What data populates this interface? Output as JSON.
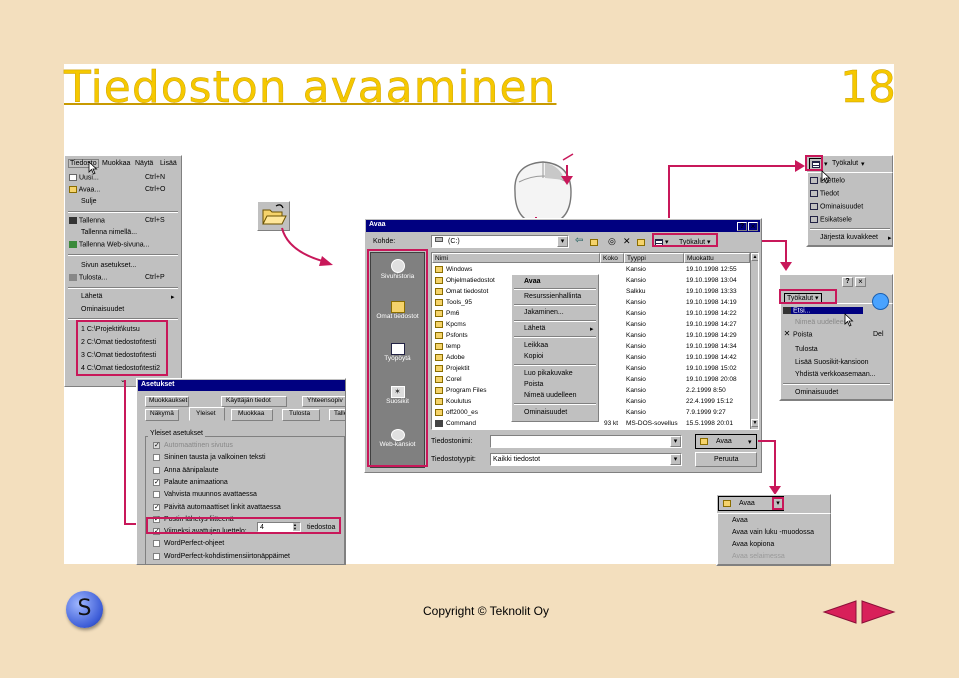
{
  "slide": {
    "title": "Tiedoston avaaminen",
    "page": "18",
    "footer": "Copyright © Teknolit Oy",
    "logo_letter": "S"
  },
  "menu": {
    "bar": [
      "Tiedosto",
      "Muokkaa",
      "Näytä",
      "Lisää"
    ],
    "items": [
      {
        "label": "Uusi...",
        "shortcut": "Ctrl+N"
      },
      {
        "label": "Avaa...",
        "shortcut": "Ctrl+O"
      },
      {
        "label": "Sulje",
        "shortcut": ""
      },
      {
        "label": "Tallenna",
        "shortcut": "Ctrl+S"
      },
      {
        "label": "Tallenna nimellä...",
        "shortcut": ""
      },
      {
        "label": "Tallenna Web-sivuna...",
        "shortcut": ""
      },
      {
        "label": "Sivun asetukset...",
        "shortcut": ""
      },
      {
        "label": "Tulosta...",
        "shortcut": "Ctrl+P"
      },
      {
        "label": "Lähetä",
        "shortcut": "▸"
      },
      {
        "label": "Ominaisuudet",
        "shortcut": ""
      }
    ],
    "recent": [
      "1 C:\\Projektit\\kutsu",
      "2 C:\\Omat tiedostot\\testi",
      "3 C:\\Omat tiedostot\\testi",
      "4 C:\\Omat tiedostot\\testi2"
    ],
    "more": "⌄"
  },
  "dialog": {
    "title": "Avaa",
    "help": "?",
    "close": "×",
    "lookin_label": "Kohde:",
    "lookin_value": "(C:)",
    "tools": "Työkalut",
    "places": [
      "Sivuhistoria",
      "Omat tiedostot",
      "Työpöytä",
      "Suosikit",
      "Web-kansiot"
    ],
    "columns": [
      "Nimi",
      "Koko",
      "Tyyppi",
      "Muokattu"
    ],
    "files": [
      {
        "name": "Windows",
        "size": "",
        "type": "Kansio",
        "date": "19.10.1998 12:55"
      },
      {
        "name": "Ohjelmatiedostot",
        "size": "",
        "type": "Kansio",
        "date": "19.10.1998 13:04"
      },
      {
        "name": "Omat tiedostot",
        "size": "",
        "type": "Salkku",
        "date": "19.10.1998 13:33"
      },
      {
        "name": "Tools_95",
        "size": "",
        "type": "Kansio",
        "date": "19.10.1998 14:19"
      },
      {
        "name": "Pm6",
        "size": "",
        "type": "Kansio",
        "date": "19.10.1998 14:22"
      },
      {
        "name": "Kpcms",
        "size": "",
        "type": "Kansio",
        "date": "19.10.1998 14:27"
      },
      {
        "name": "Psfonts",
        "size": "",
        "type": "Kansio",
        "date": "19.10.1998 14:29"
      },
      {
        "name": "temp",
        "size": "",
        "type": "Kansio",
        "date": "19.10.1998 14:34"
      },
      {
        "name": "Adobe",
        "size": "",
        "type": "Kansio",
        "date": "19.10.1998 14:42"
      },
      {
        "name": "Projektit",
        "size": "",
        "type": "Kansio",
        "date": "19.10.1998 15:02"
      },
      {
        "name": "Corel",
        "size": "",
        "type": "Kansio",
        "date": "19.10.1998 20:08"
      },
      {
        "name": "Program Files",
        "size": "",
        "type": "Kansio",
        "date": "2.2.1999 8:50"
      },
      {
        "name": "Koulutus",
        "size": "",
        "type": "Kansio",
        "date": "22.4.1999 15:12"
      },
      {
        "name": "off2000_es",
        "size": "",
        "type": "Kansio",
        "date": "7.9.1999 9:27"
      },
      {
        "name": "Command",
        "size": "93 kt",
        "type": "MS-DOS-sovellus",
        "date": "15.5.1998 20:01"
      }
    ],
    "filename_label": "Tiedostonimi:",
    "filename_value": "",
    "filetype_label": "Tiedostotyypit:",
    "filetype_value": "Kaikki tiedostot",
    "open_button": "Avaa",
    "cancel_button": "Peruuta"
  },
  "context_menu": [
    "Avaa",
    "Resurssienhallinta",
    "Jakaminen...",
    "Lähetä",
    "Leikkaa",
    "Kopioi",
    "Luo pikakuvake",
    "Poista",
    "Nimeä uudelleen",
    "Ominaisuudet"
  ],
  "views_menu": {
    "button": "Työkalut",
    "items": [
      "Luettelo",
      "Tiedot",
      "Ominaisuudet",
      "Esikatsele",
      "Järjestä kuvakkeet"
    ]
  },
  "tools_menu": {
    "button": "Työkalut",
    "items": [
      "Etsi...",
      "Nimeä uudelleen",
      "Poista",
      "Tulosta",
      "Lisää Suosikit-kansioon",
      "Yhdistä verkkoasemaan...",
      "Ominaisuudet"
    ],
    "del": "Del"
  },
  "open_menu": {
    "button": "Avaa",
    "items": [
      "Avaa",
      "Avaa vain luku -muodossa",
      "Avaa kopiona",
      "Avaa selaimessa"
    ]
  },
  "options": {
    "title": "Asetukset",
    "tabs_row1": [
      "Muokkaukset",
      "Käyttäjän tiedot",
      "Yhteensopiv"
    ],
    "tabs_row2": [
      "Näkymä",
      "Yleiset",
      "Muokkaa",
      "Tulosta",
      "Talle"
    ],
    "group": "Yleiset asetukset",
    "items": [
      {
        "label": "Automaattinen sivutus",
        "checked": true,
        "disabled": true
      },
      {
        "label": "Sininen tausta ja valkoinen teksti",
        "checked": false
      },
      {
        "label": "Anna äänipalaute",
        "checked": false
      },
      {
        "label": "Palaute animaationa",
        "checked": true
      },
      {
        "label": "Vahvista muunnos avattaessa",
        "checked": false
      },
      {
        "label": "Päivitä automaattiset linkit avattaessa",
        "checked": true
      },
      {
        "label": "Postin lähetys liitteenä",
        "checked": true
      },
      {
        "label": "Viimeksi avattujen luettelo:",
        "checked": true
      },
      {
        "label": "WordPerfect-ohjeet",
        "checked": false
      },
      {
        "label": "WordPerfect-kohdistimensiirtonäppäimet",
        "checked": false
      }
    ],
    "recent_count": "4",
    "recent_unit": "tiedostoa"
  },
  "colors": {
    "accent": "#c8185a",
    "title": "#f5c800",
    "winblue": "#000080"
  }
}
